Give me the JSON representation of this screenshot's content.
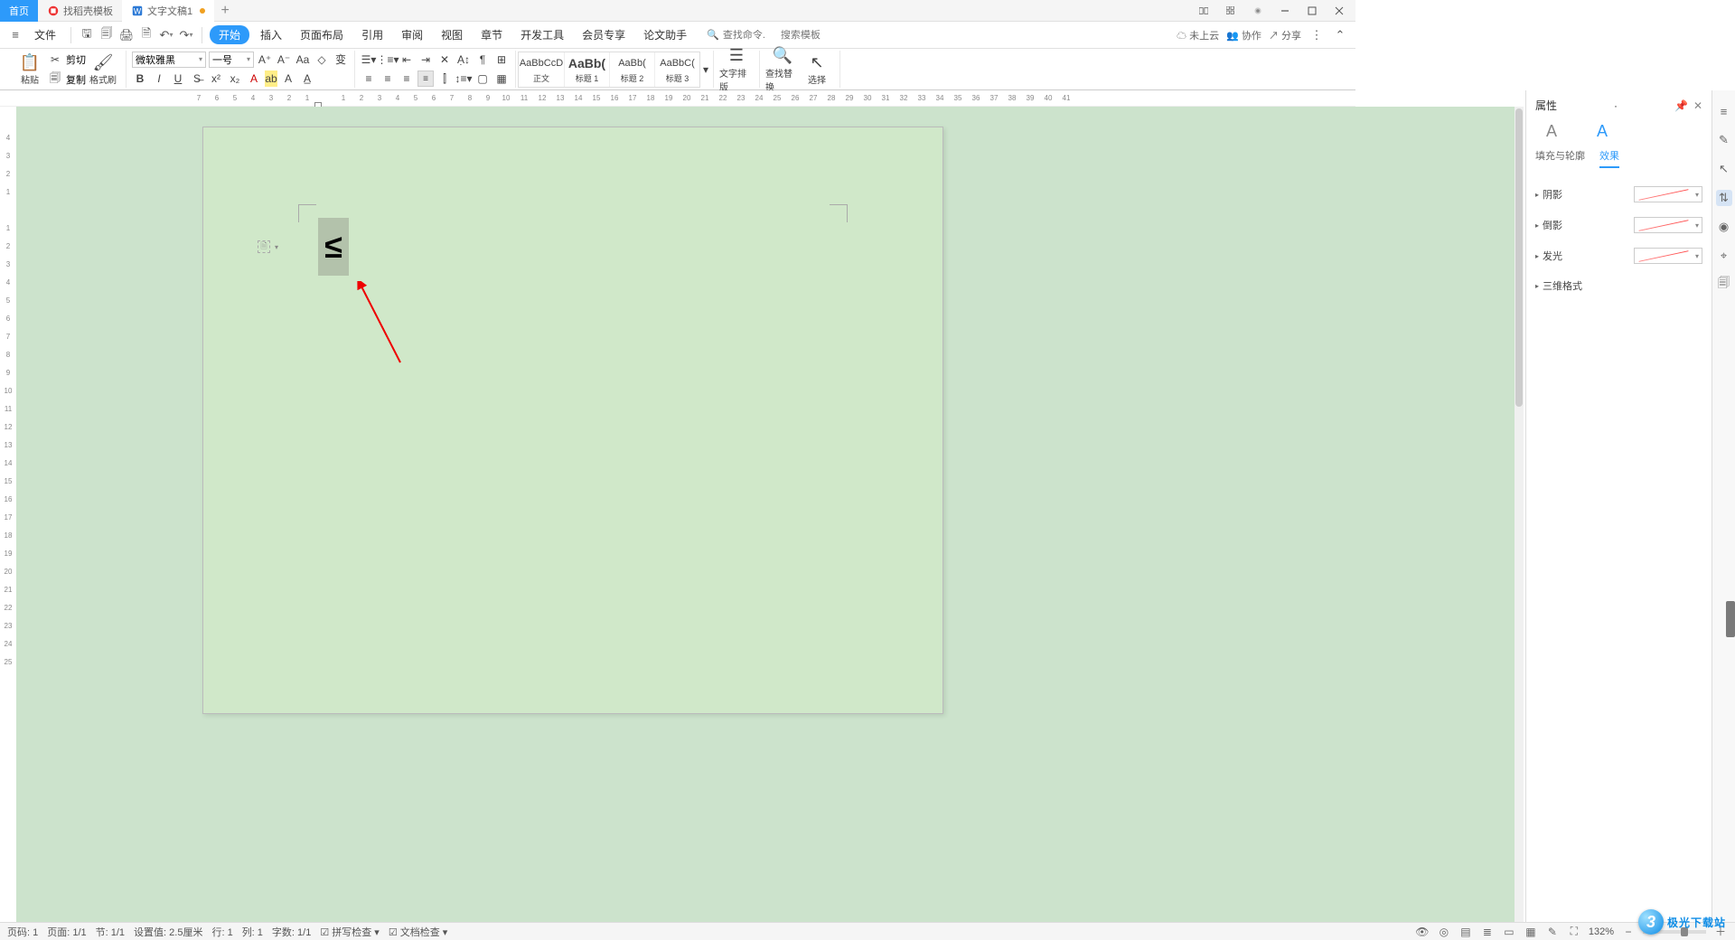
{
  "tabs": {
    "home": "首页",
    "template": "找稻壳模板",
    "doc1": "文字文稿1"
  },
  "menubar": {
    "file": "文件",
    "items": [
      "开始",
      "插入",
      "页面布局",
      "引用",
      "审阅",
      "视图",
      "章节",
      "开发工具",
      "会员专享",
      "论文助手"
    ],
    "search_cmd_placeholder": "查找命令.",
    "search_tpl_placeholder": "搜索模板",
    "cloud": "未上云",
    "collab": "协作",
    "share": "分享"
  },
  "toolbar": {
    "paste": "粘贴",
    "cut": "剪切",
    "copy": "复制",
    "format_painter": "格式刷",
    "font_name": "微软雅黑",
    "font_size": "一号",
    "layout_btn": "文字排版",
    "find_replace": "查找替换",
    "select": "选择",
    "styles": [
      {
        "preview": "AaBbCcD",
        "label": "正文"
      },
      {
        "preview": "AaBb(",
        "label": "标题 1"
      },
      {
        "preview": "AaBb(",
        "label": "标题 2"
      },
      {
        "preview": "AaBbC(",
        "label": "标题 3"
      }
    ]
  },
  "ruler_h": [
    "7",
    "6",
    "5",
    "4",
    "3",
    "2",
    "1",
    "",
    "1",
    "2",
    "3",
    "4",
    "5",
    "6",
    "7",
    "8",
    "9",
    "10",
    "11",
    "12",
    "13",
    "14",
    "15",
    "16",
    "17",
    "18",
    "19",
    "20",
    "21",
    "22",
    "23",
    "24",
    "25",
    "26",
    "27",
    "28",
    "29",
    "30",
    "31",
    "32",
    "33",
    "34",
    "35",
    "36",
    "37",
    "38",
    "39",
    "40",
    "41"
  ],
  "ruler_v": [
    "4",
    "3",
    "2",
    "1",
    "",
    "1",
    "2",
    "3",
    "4",
    "5",
    "6",
    "7",
    "8",
    "9",
    "10",
    "11",
    "12",
    "13",
    "14",
    "15",
    "16",
    "17",
    "18",
    "19",
    "20",
    "21",
    "22",
    "23",
    "24",
    "25"
  ],
  "page": {
    "symbol": "≤"
  },
  "rightpanel": {
    "title": "属性",
    "sub_fill": "填充与轮廓",
    "sub_effect": "效果",
    "sections": [
      "阴影",
      "倒影",
      "发光",
      "三维格式"
    ]
  },
  "status": {
    "page_no": "页码: 1",
    "page": "页面: 1/1",
    "section": "节: 1/1",
    "pos": "设置值: 2.5厘米",
    "row": "行: 1",
    "col": "列: 1",
    "words": "字数: 1/1",
    "spell": "拼写检查",
    "doccheck": "文档检查",
    "zoom": "132%"
  },
  "watermark": {
    "text": "极光下载站"
  }
}
